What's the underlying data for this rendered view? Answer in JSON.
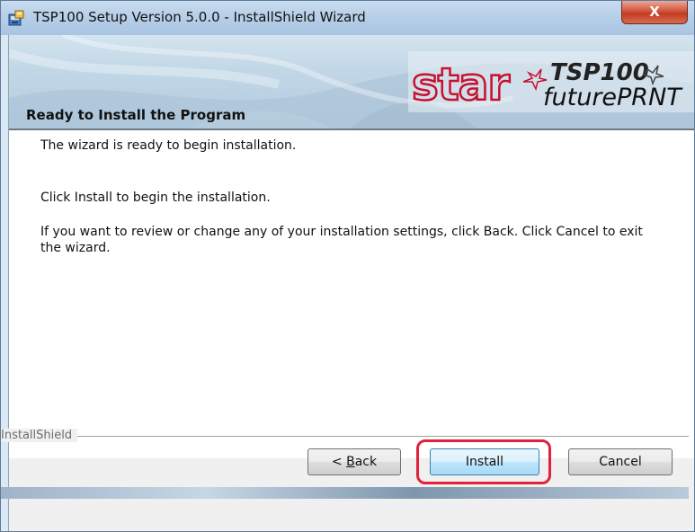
{
  "window": {
    "title": "TSP100 Setup Version 5.0.0 - InstallShield Wizard",
    "close_label": "X",
    "icon": "installer-icon"
  },
  "banner": {
    "logo_brand": "star",
    "logo_product": "TSP100",
    "logo_tagline": "futurePRNT"
  },
  "page": {
    "heading": "Ready to Install the Program",
    "subtitle": "The wizard is ready to begin installation.",
    "instruction": "Click Install to begin the installation.",
    "review_text": "If you want to review or change any of your installation settings, click Back. Click Cancel to exit the wizard."
  },
  "footer": {
    "brand": "InstallShield"
  },
  "buttons": {
    "back_prefix": "< ",
    "back_accel": "B",
    "back_rest": "ack",
    "install": "Install",
    "cancel": "Cancel"
  },
  "colors": {
    "highlight_frame": "#e0223a",
    "brand_red": "#c8102e"
  }
}
